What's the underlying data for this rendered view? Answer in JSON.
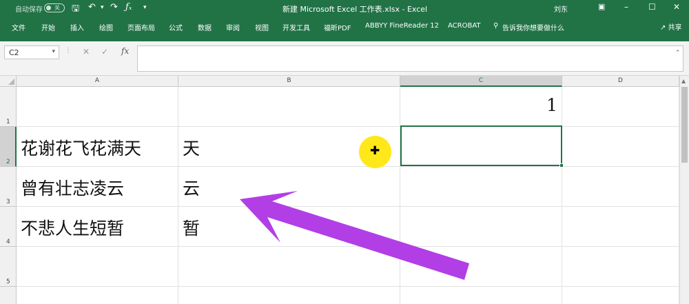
{
  "titlebar": {
    "autosave": "自动保存",
    "toggle": "关",
    "title": "新建 Microsoft Excel 工作表.xlsx  -  Excel",
    "user": "刘东"
  },
  "ribbon": {
    "tabs": [
      "文件",
      "开始",
      "插入",
      "绘图",
      "页面布局",
      "公式",
      "数据",
      "审阅",
      "视图",
      "开发工具",
      "福昕PDF",
      "ABBYY FineReader 12",
      "ACROBAT",
      "告诉我你想要做什么"
    ],
    "share": "共享"
  },
  "formula_bar": {
    "name_box": "C2",
    "fx": "fx",
    "formula": ""
  },
  "sheet": {
    "columns": [
      "A",
      "B",
      "C",
      "D"
    ],
    "rows": [
      "1",
      "2",
      "3",
      "4",
      "5"
    ],
    "cells": {
      "C1": "1",
      "A2": "花谢花飞花满天",
      "B2": "天",
      "A3": "曾有壮志凌云",
      "B3": "云",
      "A4": "不悲人生短暂",
      "B4": "暂"
    },
    "selected_cell": "C2"
  },
  "colors": {
    "excel_green": "#217346",
    "cursor_highlight": "#ffe81a",
    "annotation_arrow": "#b23ee6"
  }
}
